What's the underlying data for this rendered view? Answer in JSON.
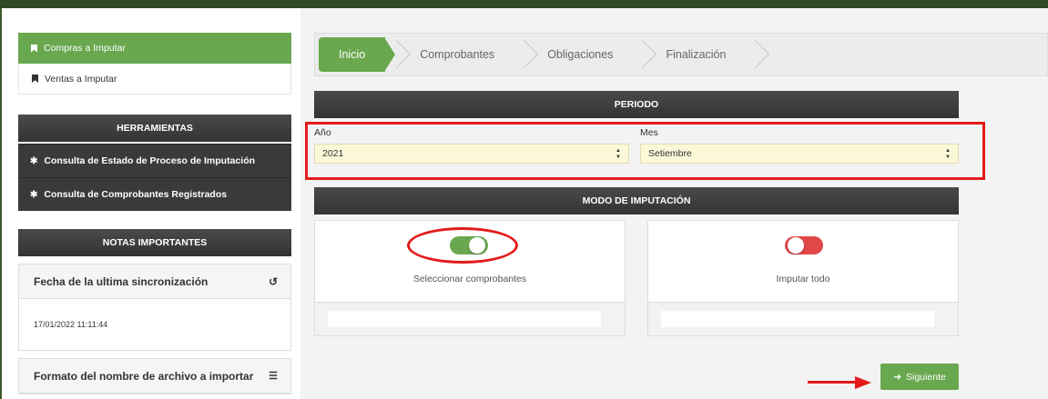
{
  "sidebar": {
    "links": [
      {
        "label": "Compras a Imputar",
        "active": true
      },
      {
        "label": "Ventas a Imputar",
        "active": false
      }
    ],
    "tools_header": "HERRAMIENTAS",
    "tools": [
      "Consulta de Estado de Proceso de Imputación",
      "Consulta de Comprobantes Registrados"
    ],
    "notes_header": "NOTAS IMPORTANTES",
    "notes": [
      {
        "title": "Fecha de la ultima sincronización",
        "icon": "history-icon",
        "body": "17/01/2022 11:11:44"
      },
      {
        "title": "Formato del nombre de archivo a importar",
        "icon": "list-icon"
      }
    ]
  },
  "wizard": {
    "steps": [
      "Inicio",
      "Comprobantes",
      "Obligaciones",
      "Finalización"
    ],
    "active_step": 0
  },
  "periodo": {
    "header": "PERIODO",
    "year_label": "Año",
    "year_value": "2021",
    "month_label": "Mes",
    "month_value": "Setiembre"
  },
  "modo": {
    "header": "MODO DE IMPUTACIÓN",
    "options": [
      {
        "label": "Seleccionar comprobantes",
        "on": true
      },
      {
        "label": "Imputar todo",
        "on": false
      }
    ]
  },
  "actions": {
    "next_label": "Siguiente"
  },
  "colors": {
    "accent": "#6aa84f",
    "danger": "#e04848",
    "annotation": "#e41b1b"
  }
}
